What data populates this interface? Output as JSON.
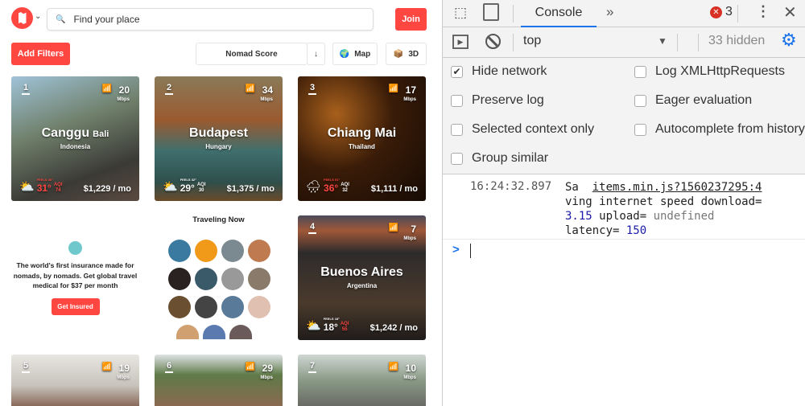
{
  "app": {
    "search_placeholder": "Find your place",
    "join": "Join",
    "add_filters": "Add Filters",
    "sort": "Nomad Score",
    "sort_dir": "↓",
    "map": "Map",
    "three_d": "3D",
    "cards": [
      {
        "rank": "1",
        "speed": "20",
        "unit": "Mbps",
        "city": "Canggu",
        "region": "Bali",
        "country": "Indonesia",
        "feels": "FEELS 36°",
        "temp": "31°",
        "aqi_label": "AQI",
        "aqi": "74",
        "cost": "$1,229 / mo",
        "weather": "partly-cloudy-icon",
        "bg": "linear-gradient(160deg,#9fc3d8 0%,#6f7f6a 40%,#3b3a36 75%,#5a4a40 100%)"
      },
      {
        "rank": "2",
        "speed": "34",
        "unit": "Mbps",
        "city": "Budapest",
        "region": "",
        "country": "Hungary",
        "feels": "FEELS 32°",
        "temp": "29°",
        "aqi_label": "AQI",
        "aqi": "30",
        "cost": "$1,375 / mo",
        "weather": "partly-cloudy-icon",
        "bg": "linear-gradient(180deg,#8a7a58 0%,#9a5a30 35%,#3f6f6e 60%,#2f4f4c 85%,#6a4a2a 100%)"
      },
      {
        "rank": "3",
        "speed": "17",
        "unit": "Mbps",
        "city": "Chiang Mai",
        "region": "",
        "country": "Thailand",
        "feels": "FEELS 51°",
        "temp": "36°",
        "aqi_label": "AQI",
        "aqi": "32",
        "cost": "$1,111 / mo",
        "weather": "rain-icon",
        "bg": "radial-gradient(circle at 30% 30%,#a8601c 0%,#3a1c08 45%,#160a04 100%)"
      },
      {
        "rank": "4",
        "speed": "7",
        "unit": "Mbps",
        "city": "Buenos Aires",
        "region": "",
        "country": "Argentina",
        "feels": "FEELS 18°",
        "temp": "18°",
        "aqi_label": "AQI",
        "aqi": "55",
        "cost": "$1,242 / mo",
        "weather": "partly-cloudy-icon",
        "bg": "linear-gradient(180deg,#4a4a5a 0%,#a05838 12%,#2e2b2c 30%,#4a3a2c 70%,#201c1a 100%)"
      },
      {
        "rank": "5",
        "speed": "19",
        "unit": "Mbps",
        "bg": "linear-gradient(180deg,#e8e6e2 0%,#c8c4bc 60%,#8a6a5a 100%)"
      },
      {
        "rank": "6",
        "speed": "29",
        "unit": "Mbps",
        "bg": "linear-gradient(180deg,#dfe3e6 0%,#5f7a48 40%,#8a6a50 100%)"
      },
      {
        "rank": "7",
        "speed": "10",
        "unit": "Mbps",
        "bg": "linear-gradient(180deg,#cfd6d2 0%,#8a9a86 50%,#6a6a66 100%)"
      }
    ],
    "insurance": {
      "text": "The world's first insurance made for nomads, by nomads. Get global travel medical for $37 per month",
      "button": "Get Insured"
    },
    "traveling": {
      "title": "Traveling Now",
      "avatars": [
        "#3a7aa0",
        "#f19a1a",
        "#7a8a90",
        "#c07a50",
        "#2a2220",
        "#3a5a6a",
        "#999",
        "#8a7a6a",
        "#6a5030",
        "#444",
        "#5a7a9a",
        "#e0c0b0",
        "#d0a070",
        "#5a7ab0",
        "#6a5a5a"
      ]
    }
  },
  "devtools": {
    "tab": "Console",
    "more": "»",
    "errors": "3",
    "context": "top",
    "hidden": "33 hidden",
    "settings": [
      {
        "label": "Hide network",
        "checked": true
      },
      {
        "label": "Log XMLHttpRequests",
        "checked": false
      },
      {
        "label": "Preserve log",
        "checked": false
      },
      {
        "label": "Eager evaluation",
        "checked": false
      },
      {
        "label": "Selected context only",
        "checked": false
      },
      {
        "label": "Autocomplete from history",
        "checked": false
      },
      {
        "label": "Group similar",
        "checked": false
      }
    ],
    "log": {
      "time": "16:24:32.897",
      "prefix": "Sa",
      "source": "items.min.js?1560237295:4",
      "line1": "ving internet speed download=",
      "download": "3.15",
      "upload_label": " upload= ",
      "upload": "undefined",
      "latency_label": "latency= ",
      "latency": "150"
    },
    "prompt": ">"
  },
  "colors": {
    "brand": "#ff4742",
    "devtools_blue": "#1a73e8"
  }
}
